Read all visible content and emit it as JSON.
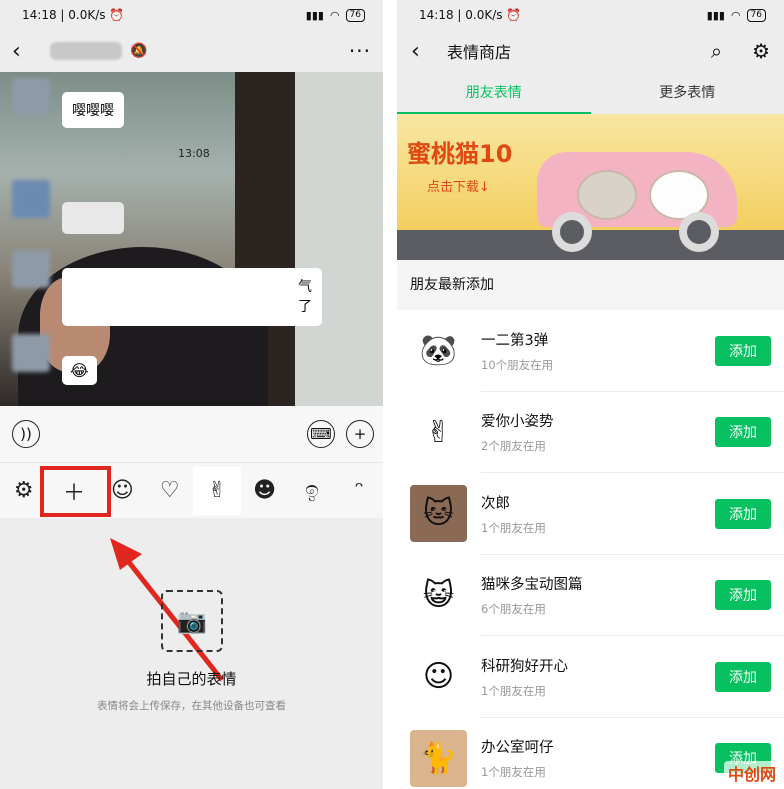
{
  "left": {
    "status": {
      "time": "14:18",
      "speed": "0.0K/s",
      "battery": "76"
    },
    "chat": {
      "message1": "嘤嘤嘤",
      "time_label": "13:08",
      "message3_tail": "气\n了",
      "message4_emoji": "😂"
    },
    "tabs": [
      {
        "icon": "settings",
        "glyph": "⚙"
      },
      {
        "icon": "add",
        "glyph": "＋"
      },
      {
        "icon": "emoji-smile",
        "glyph": "☺"
      },
      {
        "icon": "heart",
        "glyph": "♡"
      },
      {
        "icon": "gesture-sticker",
        "glyph": "✌"
      },
      {
        "icon": "face-sticker",
        "glyph": "☻"
      },
      {
        "icon": "ghost-sticker",
        "glyph": "ඉ"
      },
      {
        "icon": "bunny-sticker",
        "glyph": "ᵔ"
      }
    ],
    "panel": {
      "title": "拍自己的表情",
      "subtitle": "表情将会上传保存，在其他设备也可查看"
    },
    "highlight_color": "#e0261f"
  },
  "right": {
    "status": {
      "time": "14:18",
      "speed": "0.0K/s",
      "battery": "76"
    },
    "header": {
      "title": "表情商店"
    },
    "tabs": {
      "friends": "朋友表情",
      "more": "更多表情"
    },
    "banner": {
      "title": "蜜桃猫10",
      "subtitle": "点击下载↓"
    },
    "section_label": "朋友最新添加",
    "add_label": "添加",
    "packs": [
      {
        "name": "一二第3弹",
        "users": "10个朋友在用",
        "glyph": "🐼"
      },
      {
        "name": "爱你小姿势",
        "users": "2个朋友在用",
        "glyph": "✌"
      },
      {
        "name": "次郎",
        "users": "1个朋友在用",
        "glyph": "🐱"
      },
      {
        "name": "猫咪多宝动图篇",
        "users": "6个朋友在用",
        "glyph": "😺"
      },
      {
        "name": "科研狗好开心",
        "users": "1个朋友在用",
        "glyph": "☺"
      },
      {
        "name": "办公室呵仔",
        "users": "1个朋友在用",
        "glyph": "🐈"
      }
    ],
    "accent_color": "#07c160",
    "watermark": "中创网"
  }
}
